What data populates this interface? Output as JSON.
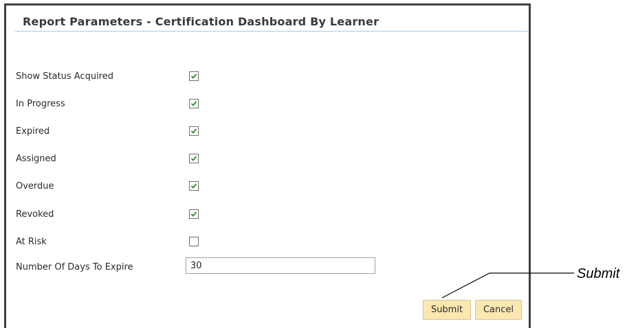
{
  "dialog": {
    "title": "Report Parameters - Certification Dashboard By Learner"
  },
  "parameters": [
    {
      "label": "Show Status Acquired",
      "checked": true
    },
    {
      "label": "In Progress",
      "checked": true
    },
    {
      "label": "Expired",
      "checked": true
    },
    {
      "label": "Assigned",
      "checked": true
    },
    {
      "label": "Overdue",
      "checked": true
    },
    {
      "label": "Revoked",
      "checked": true
    },
    {
      "label": "At Risk",
      "checked": false
    }
  ],
  "days_to_expire": {
    "label": "Number Of Days To Expire",
    "value": "30"
  },
  "buttons": {
    "submit": "Submit",
    "cancel": "Cancel"
  },
  "callout": {
    "label": "Submit"
  },
  "colors": {
    "button_bg": "#fde7b0",
    "check_green": "#2e8b2e",
    "title_rule": "#a9c9e6"
  }
}
